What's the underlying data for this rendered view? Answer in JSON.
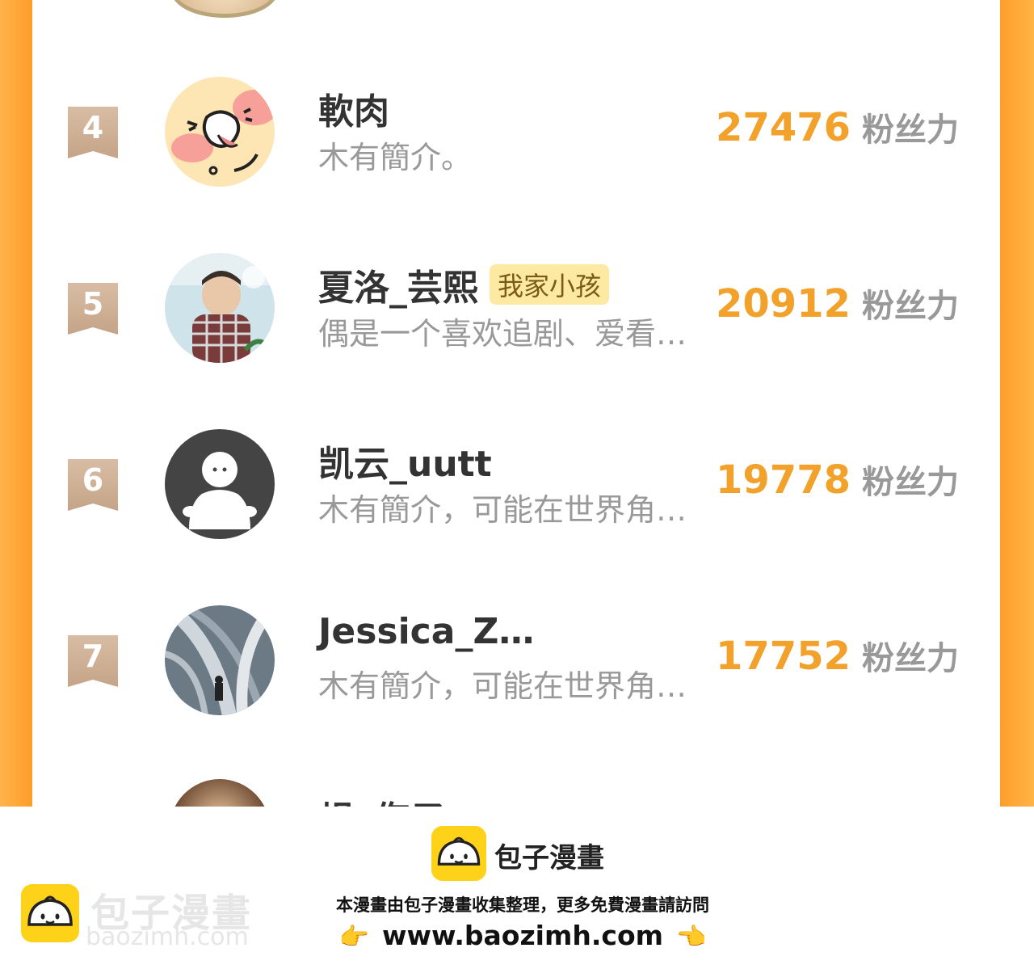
{
  "ranking": {
    "rows": [
      {
        "rank": "4",
        "name": "軟肉",
        "tag": "",
        "desc": "木有簡介。",
        "score": "27476",
        "unit": "粉丝力",
        "avatar_icon": "cartoon-face-avatar"
      },
      {
        "rank": "5",
        "name": "夏洛_芸熙",
        "tag": "我家小孩",
        "desc": "偶是一个喜欢追剧、爱看…",
        "score": "20912",
        "unit": "粉丝力",
        "avatar_icon": "child-photo-avatar"
      },
      {
        "rank": "6",
        "name": "凯云_uutt",
        "tag": "",
        "desc": "木有簡介，可能在世界角…",
        "score": "19778",
        "unit": "粉丝力",
        "avatar_icon": "default-ghost-avatar"
      },
      {
        "rank": "7",
        "name": "Jessica_Z…",
        "tag": "",
        "desc": "木有簡介，可能在世界角…",
        "score": "17752",
        "unit": "粉丝力",
        "avatar_icon": "staircase-photo-avatar"
      }
    ],
    "partial_name": "焆c侮孒"
  },
  "footer": {
    "brand": "包子漫畫",
    "tagline": "本漫畫由包子漫畫收集整理，更多免費漫畫請訪問",
    "url": "www.baozimh.com",
    "watermark_title": "包子漫畫",
    "watermark_url": "baozimh.com",
    "hand_left": "👉",
    "hand_right": "👈"
  }
}
